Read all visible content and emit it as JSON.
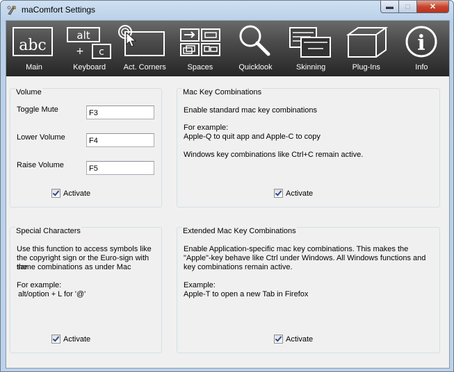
{
  "window": {
    "title": "maComfort Settings"
  },
  "toolbar": {
    "items": [
      {
        "label": "Main",
        "icon": "abc-icon"
      },
      {
        "label": "Keyboard",
        "icon": "keyboard-icon"
      },
      {
        "label": "Act. Corners",
        "icon": "active-corners-icon"
      },
      {
        "label": "Spaces",
        "icon": "spaces-icon"
      },
      {
        "label": "Quicklook",
        "icon": "magnifier-icon"
      },
      {
        "label": "Skinning",
        "icon": "skinning-icon"
      },
      {
        "label": "Plug-Ins",
        "icon": "cube-icon"
      },
      {
        "label": "Info",
        "icon": "info-icon"
      }
    ],
    "main_icon_text": "abc",
    "keyboard_alt": "alt",
    "keyboard_plus": "+",
    "keyboard_c": "c",
    "info_glyph": "i"
  },
  "volume": {
    "title": "Volume",
    "toggle_label": "Toggle Mute",
    "toggle_value": "F3",
    "lower_label": "Lower Volume",
    "lower_value": "F4",
    "raise_label": "Raise Volume",
    "raise_value": "F5",
    "activate": "Activate"
  },
  "mac_keys": {
    "title": "Mac Key Combinations",
    "line1": "Enable standard mac key combinations",
    "line2": "For example:",
    "line3": "Apple-Q to quit app and Apple-C to copy",
    "line4": "Windows key combinations like Ctrl+C remain active.",
    "activate": "Activate"
  },
  "special_chars": {
    "title": "Special Characters",
    "line1": "Use this function to access symbols like",
    "line2": "the copyright sign or the Euro-sign with the",
    "line3": "same combinations as under Mac",
    "line4": "For example:",
    "line5": "alt/option + L for '@'",
    "activate": "Activate"
  },
  "extended_keys": {
    "title": "Extended Mac Key Combinations",
    "line1": "Enable Application-specific mac key combinations. This makes the",
    "line2": "\"Apple\"-key behave like Ctrl under Windows. All Windows functions and",
    "line3": "key combinations remain active.",
    "line4": "Example:",
    "line5": "Apple-T to open a new Tab in Firefox",
    "activate": "Activate"
  },
  "colors": {
    "toolbar_top": "#6a6a6a",
    "toolbar_bottom": "#262626",
    "panel_bg": "#f0f0f0",
    "close_red": "#c8462f"
  }
}
